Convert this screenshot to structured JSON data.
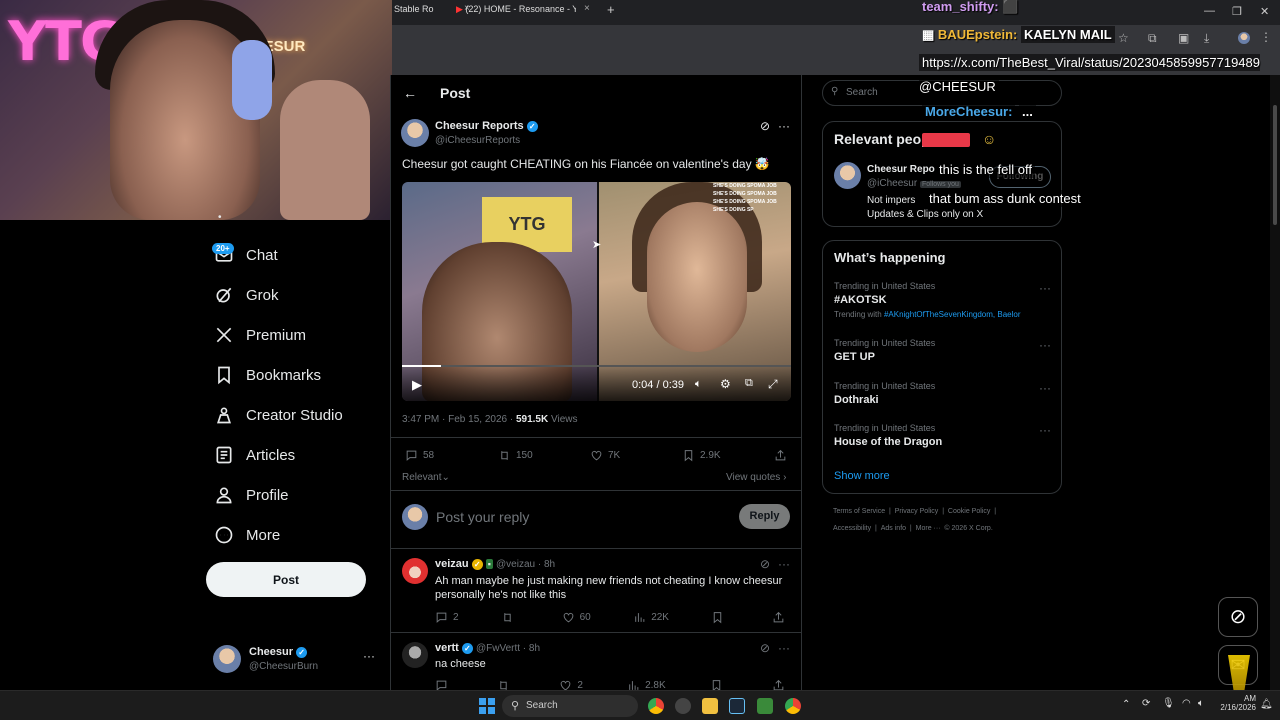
{
  "browser": {
    "tabs": [
      {
        "label": "Stable Ro"
      },
      {
        "label": "(22) HOME - Resonance - Y"
      }
    ]
  },
  "webcam": {
    "neon_text": "YTG",
    "sign_text": "CHEESUR"
  },
  "nav": {
    "chat_badge": "20+",
    "items": [
      {
        "label": "Chat",
        "icon": "chat-icon"
      },
      {
        "label": "Grok",
        "icon": "grok-icon"
      },
      {
        "label": "Premium",
        "icon": "x-logo-icon"
      },
      {
        "label": "Bookmarks",
        "icon": "bookmark-icon"
      },
      {
        "label": "Creator Studio",
        "icon": "creator-icon"
      },
      {
        "label": "Articles",
        "icon": "articles-icon"
      },
      {
        "label": "Profile",
        "icon": "profile-icon"
      },
      {
        "label": "More",
        "icon": "more-circle-icon"
      }
    ],
    "post_button": "Post",
    "account": {
      "name": "Cheesur",
      "handle": "@CheesurBurn"
    }
  },
  "post": {
    "header_title": "Post",
    "author_name": "Cheesur Reports",
    "author_handle": "@iCheesurReports",
    "text": "Cheesur got caught CHEATING on his Fiancée on valentine's day 🤯",
    "video": {
      "time": "0:04 / 0:39",
      "progress": 0.1,
      "sign": "YTG",
      "overlay_text": "SHE'S DOING SPOMA JOB SHE'S DOING SPOMA JOB SHE'S DOING SPOMA JOB SHE'S DOING SP"
    },
    "timestamp": "3:47 PM · Feb 15, 2026 · ",
    "views_count": "591.5K",
    "views_label": " Views",
    "stats": {
      "replies": "58",
      "reposts": "150",
      "likes": "7K",
      "bookmarks": "2.9K"
    },
    "sort_label": "Relevant",
    "view_quotes": "View quotes ›",
    "reply_placeholder": "Post your reply",
    "reply_button": "Reply"
  },
  "replies": [
    {
      "name": "veizau",
      "handle": "@veizau · 8h",
      "text": "Ah man maybe he just making new friends not cheating I know cheesur personally he's not like this",
      "replies": "2",
      "reposts": "",
      "likes": "60",
      "views": "22K"
    },
    {
      "name": "vertt",
      "handle": "@FwVertt · 8h",
      "text": "na cheese",
      "replies": "",
      "reposts": "",
      "likes": "2",
      "views": "2.8K"
    }
  ],
  "sidebar": {
    "search_placeholder": "Search",
    "relevant_title": "Relevant people",
    "person": {
      "name": "Cheesur Repo",
      "handle": "@iCheesur",
      "follows_you": "Follows you",
      "bio_line1": "Not impers",
      "bio_line2": "Updates & Clips only on X",
      "follow_button": "Following"
    },
    "happening_title": "What’s happening",
    "trends": [
      {
        "category": "Trending in United States",
        "name": "#AKOTSK",
        "extra_prefix": "Trending with ",
        "extra": "#AKnightOfTheSevenKingdom, Baelor"
      },
      {
        "category": "Trending in United States",
        "name": "GET UP"
      },
      {
        "category": "Trending in United States",
        "name": "Dothraki"
      },
      {
        "category": "Trending in United States",
        "name": "House of the Dragon"
      }
    ],
    "show_more": "Show more",
    "footer_line1": [
      "Terms of Service",
      "|",
      "Privacy Policy",
      "|",
      "Cookie Policy",
      "|"
    ],
    "footer_line2": [
      "Accessibility",
      "|",
      "Ads info",
      "|",
      "More ···",
      "© 2026 X Corp."
    ]
  },
  "chat_overlay": {
    "line1_user": "team_shifty:",
    "line2_user": "BAUEpstein:",
    "line2_text": "KAELYN MAIL",
    "line3": "https://x.com/TheBest_Viral/status/2023045859957719489 @CHEESUR",
    "line4_user": "MoreCheesur:",
    "line4_text": "...",
    "line5": "this is the fell off",
    "line6": "that bum ass dunk contest"
  },
  "taskbar": {
    "search": "Search",
    "time": "AM",
    "date": "2/16/2026"
  }
}
